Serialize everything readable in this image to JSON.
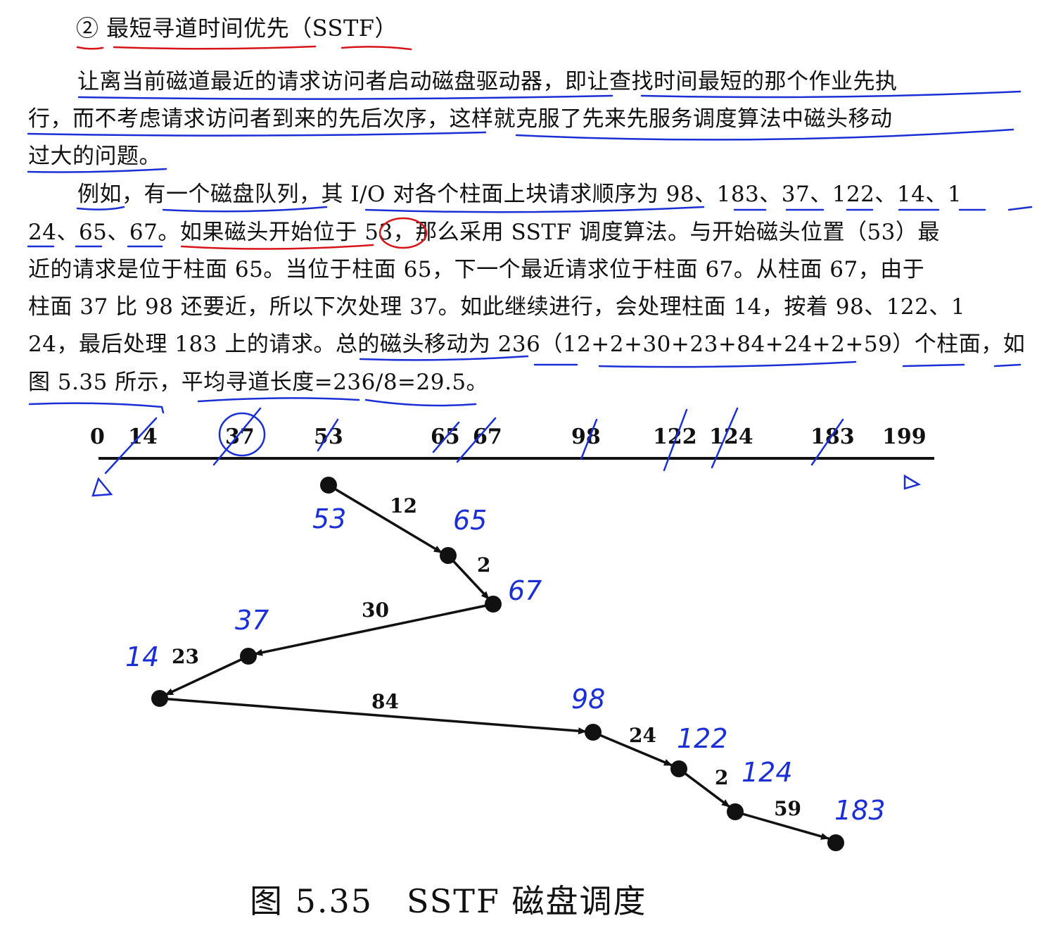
{
  "heading": "② 最短寻道时间优先（SSTF）",
  "paragraph_lines": [
    "让离当前磁道最近的请求访问者启动磁盘驱动器，即让查找时间最短的那个作业先执",
    "行，而不考虑请求访问者到来的先后次序，这样就克服了先来先服务调度算法中磁头移动",
    "过大的问题。",
    "例如，有一个磁盘队列，其 I/O 对各个柱面上块请求顺序为 98、183、37、122、14、1",
    "24、65、67。如果磁头开始位于 53，那么采用 SSTF 调度算法。与开始磁头位置（53）最",
    "近的请求是位于柱面 65。当位于柱面 65，下一个最近请求位于柱面 67。从柱面 67，由于",
    "柱面 37 比 98 还要近，所以下次处理 37。如此继续进行，会处理柱面 14，按着 98、122、1",
    "24，最后处理 183 上的请求。总的磁头移动为 236（12+2+30+23+84+24+2+59）个柱面，如",
    "图 5.35 所示，平均寻道长度=236/8=29.5。"
  ],
  "figure": {
    "axis_ticks": [
      "0",
      "14",
      "37",
      "53",
      "65",
      "67",
      "98",
      "122",
      "124",
      "183",
      "199"
    ],
    "visit_order": [
      53,
      65,
      67,
      37,
      14,
      98,
      122,
      124,
      183
    ],
    "movements": [
      "12",
      "2",
      "30",
      "23",
      "84",
      "24",
      "2",
      "59"
    ],
    "handwritten_labels": [
      "53",
      "65",
      "67",
      "37",
      "14",
      "98",
      "122",
      "124",
      "183"
    ],
    "caption": "图 5.35　SSTF 磁盘调度"
  },
  "colors": {
    "text": "#111111",
    "red_ink": "#d7141a",
    "blue_ink": "#1a2fd6"
  }
}
